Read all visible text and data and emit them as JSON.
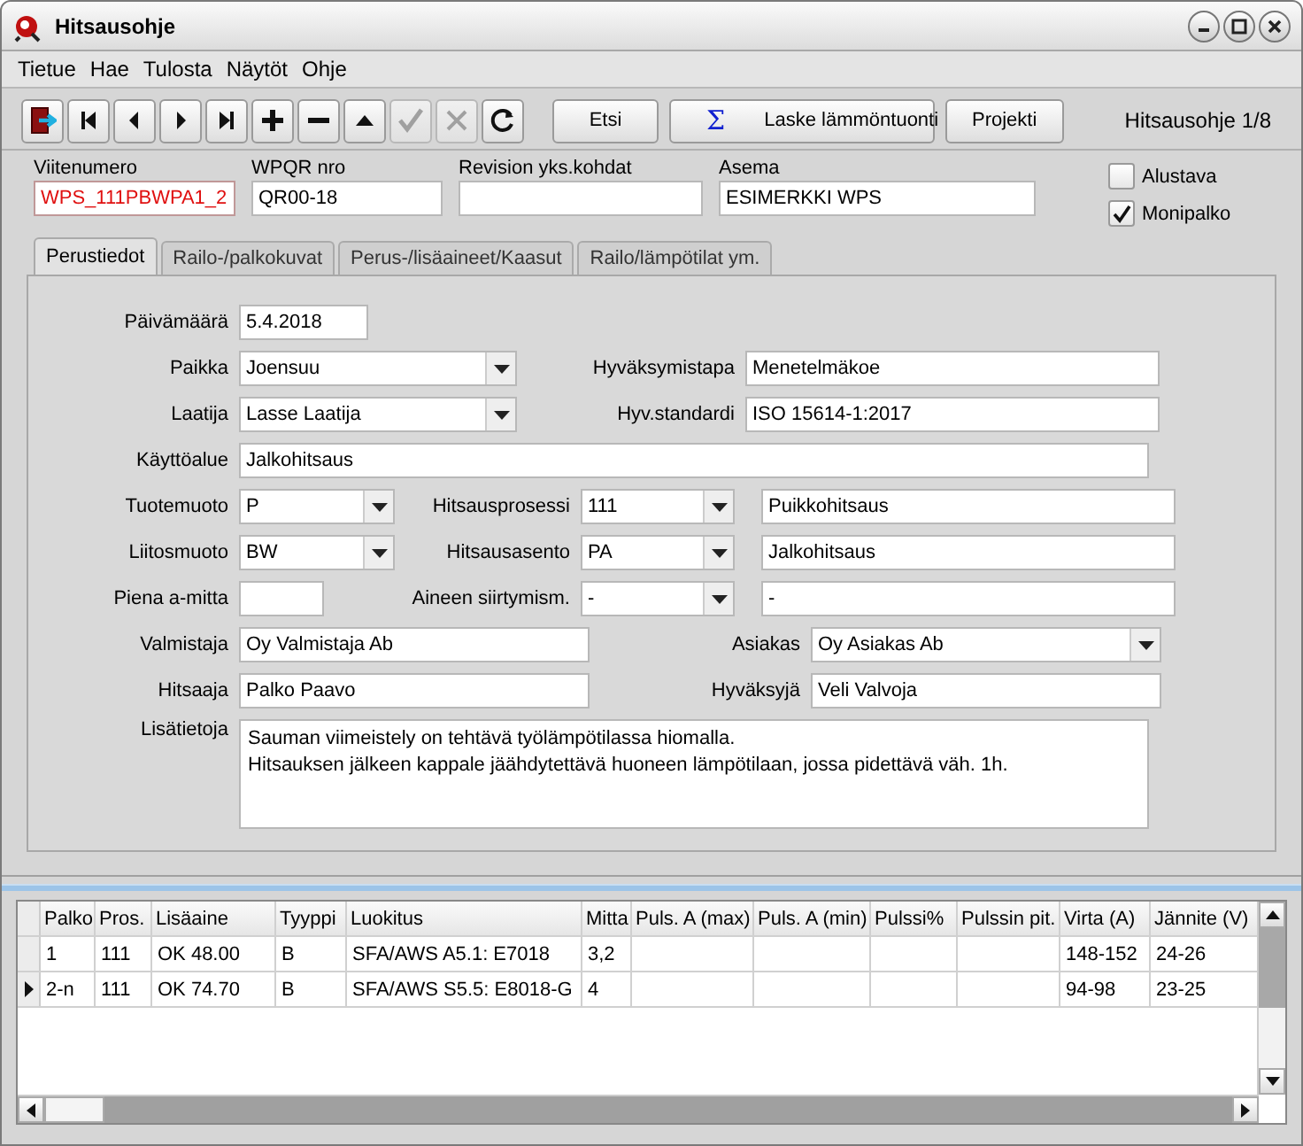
{
  "window": {
    "title": "Hitsausohje"
  },
  "menu": [
    "Tietue",
    "Hae",
    "Tulosta",
    "Näytöt",
    "Ohje"
  ],
  "toolbar": {
    "icon_buttons": [
      {
        "kind": "exit",
        "disabled": false
      },
      {
        "kind": "first",
        "disabled": false
      },
      {
        "kind": "prev",
        "disabled": false
      },
      {
        "kind": "next",
        "disabled": false
      },
      {
        "kind": "last",
        "disabled": false
      },
      {
        "kind": "add",
        "disabled": false
      },
      {
        "kind": "remove",
        "disabled": false
      },
      {
        "kind": "up",
        "disabled": false
      },
      {
        "kind": "accept",
        "disabled": true
      },
      {
        "kind": "cancel",
        "disabled": true
      },
      {
        "kind": "refresh",
        "disabled": false
      }
    ],
    "buttons": [
      {
        "label": "Etsi",
        "kind": "plain"
      },
      {
        "label": "Laske lämmöntuonti",
        "kind": "sum",
        "icon": "Σ"
      },
      {
        "label": "Projekti",
        "kind": "plain"
      }
    ],
    "record_label": "Hitsausohje 1/8"
  },
  "header_fields": [
    {
      "label": "Viitenumero",
      "value": "WPS_111PBWPA1_2",
      "error": true
    },
    {
      "label": "WPQR nro",
      "value": "QR00-18",
      "error": false
    },
    {
      "label": "Revision yks.kohdat",
      "error": false
    },
    {
      "label": "Asema",
      "value": "ESIMERKKI WPS",
      "error": false
    }
  ],
  "checkboxes": [
    {
      "label": "Alustava",
      "checked": false
    },
    {
      "label": "Monipalko",
      "checked": true
    }
  ],
  "tabs": [
    {
      "label": "Perustiedot",
      "selected": true
    },
    {
      "label": "Railo-/palkokuvat",
      "selected": false
    },
    {
      "label": "Perus-/lisäaineet/Kaasut",
      "selected": false
    },
    {
      "label": "Railo/lämpötilat ym.",
      "selected": false
    }
  ],
  "form_rows": [
    [
      {
        "label": "Päivämäärä",
        "value": "5.4.2018",
        "kind": "text"
      }
    ],
    [
      {
        "label": "Paikka",
        "value": "Joensuu",
        "kind": "combo"
      },
      {
        "label": "Hyväksymistapa",
        "value": "Menetelmäkoe",
        "kind": "text"
      }
    ],
    [
      {
        "label": "Laatija",
        "value": "Lasse Laatija",
        "kind": "combo"
      },
      {
        "label": "Hyv.standardi",
        "value": "ISO 15614-1:2017",
        "kind": "text"
      }
    ],
    [
      {
        "label": "Käyttöalue",
        "value": "Jalkohitsaus",
        "kind": "text"
      }
    ],
    [
      {
        "label": "Tuotemuoto",
        "value": "P",
        "kind": "combo"
      },
      {
        "label": "Hitsausprosessi",
        "value": "111",
        "kind": "combo"
      },
      {
        "value": "Puikkohitsaus",
        "kind": "text"
      }
    ],
    [
      {
        "label": "Liitosmuoto",
        "value": "BW",
        "kind": "combo"
      },
      {
        "label": "Hitsausasento",
        "value": "PA",
        "kind": "combo"
      },
      {
        "value": "Jalkohitsaus",
        "kind": "text"
      }
    ],
    [
      {
        "label": "Piena a-mitta",
        "kind": "text"
      },
      {
        "label": "Aineen siirtymism.",
        "value": "-",
        "kind": "combo"
      },
      {
        "value": "-",
        "kind": "text"
      }
    ],
    [
      {
        "label": "Valmistaja",
        "value": "Oy Valmistaja Ab",
        "kind": "text"
      },
      {
        "label": "Asiakas",
        "value": "Oy Asiakas Ab",
        "kind": "combo"
      }
    ],
    [
      {
        "label": "Hitsaaja",
        "value": "Palko Paavo",
        "kind": "text"
      },
      {
        "label": "Hyväksyjä",
        "value": "Veli Valvoja",
        "kind": "text"
      }
    ],
    [
      {
        "label": "Lisätietoja",
        "value": "Sauman viimeistely on tehtävä työlämpötilassa hiomalla.\nHitsauksen jälkeen kappale jäähdytettävä huoneen lämpötilaan, jossa pidettävä väh. 1h.",
        "kind": "textarea"
      }
    ]
  ],
  "table": {
    "columns": [
      "Palko",
      "Pros.",
      "Lisäaine",
      "Tyyppi",
      "Luokitus",
      "Mitta",
      "Puls. A (max)",
      "Puls. A (min)",
      "Pulssi%",
      "Pulssin pit.",
      "Virta (A)",
      "Jännite (V)"
    ],
    "rows": [
      {
        "selected": false,
        "cells": [
          "1",
          "111",
          "OK 48.00",
          "B",
          "SFA/AWS A5.1: E7018",
          "3,2",
          "",
          "",
          "",
          "",
          "148-152",
          "24-26"
        ]
      },
      {
        "selected": true,
        "cells": [
          "2-n",
          "111",
          "OK 74.70",
          "B",
          "SFA/AWS S5.5: E8018-G",
          "4",
          "",
          "",
          "",
          "",
          "94-98",
          "23-25"
        ]
      }
    ]
  }
}
